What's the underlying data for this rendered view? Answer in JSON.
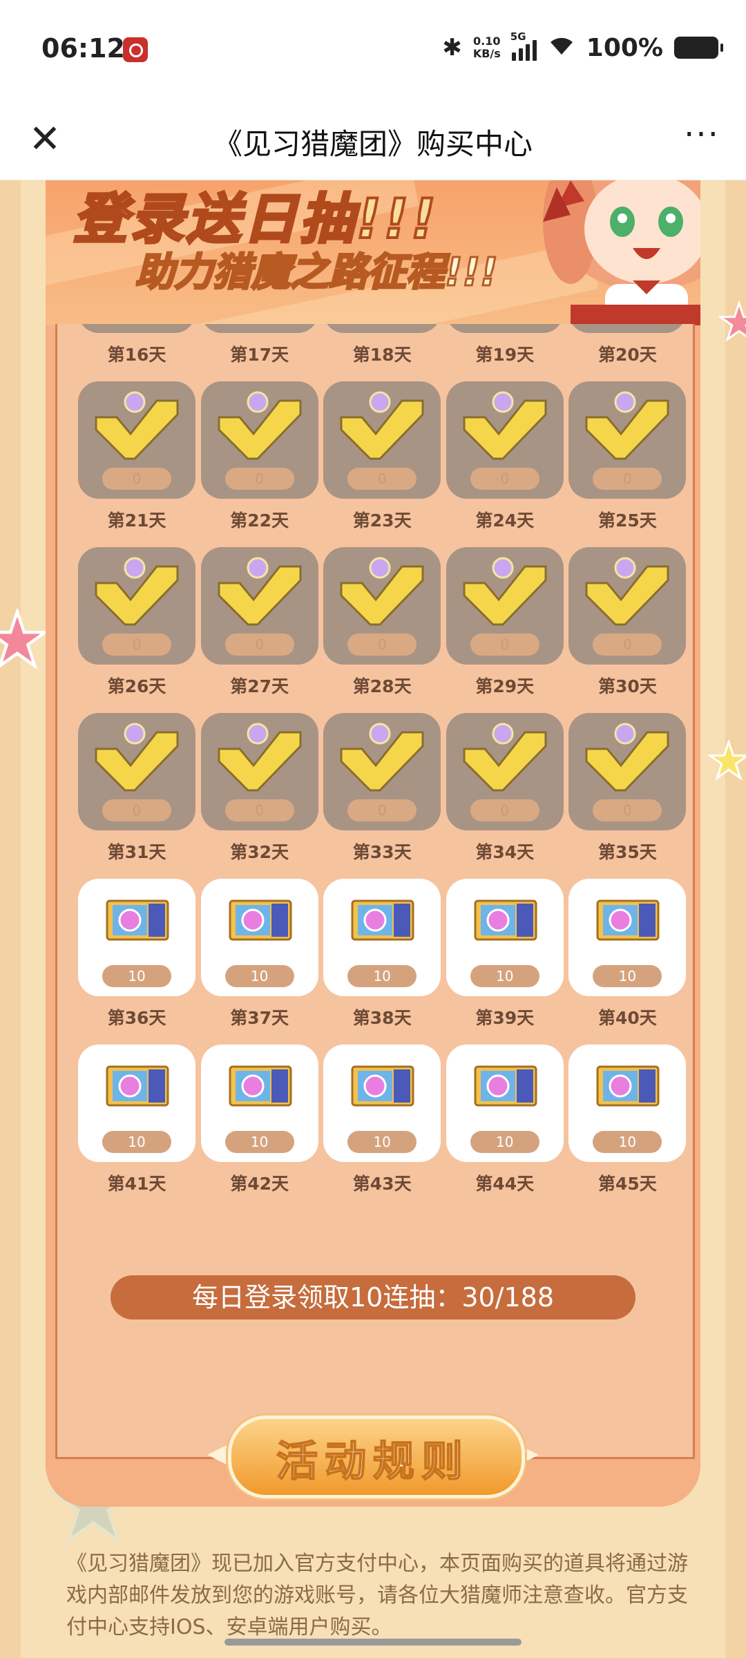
{
  "status_bar": {
    "time": "06:12",
    "speed_top": "0.10",
    "speed_bottom": "KB/s",
    "network": "5G",
    "battery": "100%"
  },
  "title_bar": {
    "title": "《见习猎魔团》购买中心",
    "close_icon": "close-icon",
    "more_icon": "more-icon",
    "close_glyph": "✕",
    "more_glyph": "···"
  },
  "banner": {
    "line1": "登录送日抽!!!",
    "line2": "助力猎魔之路征程!!!"
  },
  "rewards": {
    "claimed_count_text": "0",
    "unclaimed_count_text": "10",
    "rows": [
      [
        "第16天",
        "第17天",
        "第18天",
        "第19天",
        "第20天"
      ],
      [
        "第21天",
        "第22天",
        "第23天",
        "第24天",
        "第25天"
      ],
      [
        "第26天",
        "第27天",
        "第28天",
        "第29天",
        "第30天"
      ],
      [
        "第31天",
        "第32天",
        "第33天",
        "第34天",
        "第35天"
      ],
      [
        "第36天",
        "第37天",
        "第38天",
        "第39天",
        "第40天"
      ],
      [
        "第41天",
        "第42天",
        "第43天",
        "第44天",
        "第45天"
      ]
    ],
    "claimed_through_day": 35
  },
  "progress": {
    "text": "每日登录领取10连抽：30/188"
  },
  "rules_button": {
    "label": "活动规则"
  },
  "description": "《见习猎魔团》现已加入官方支付中心，本页面购买的道具将通过游戏内部邮件发放到您的游戏账号，请各位大猎魔师注意查收。官方支付中心支持IOS、安卓端用户购买。",
  "colors": {
    "panel": "#f5b083",
    "claimed_card": "#a89485",
    "progress_bar": "#c66c3d",
    "rules_button": "#f19a2c"
  }
}
